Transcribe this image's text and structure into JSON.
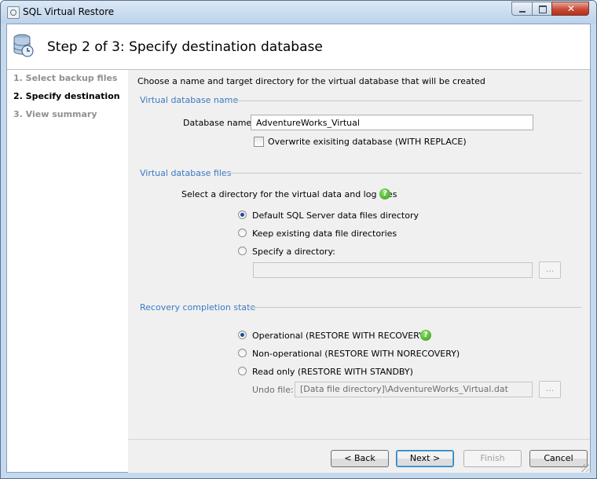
{
  "window": {
    "title": "SQL Virtual Restore",
    "header_title": "Step 2 of 3: Specify destination database",
    "icons": {
      "app": "app-icon",
      "header": "database-clock-icon",
      "close": "close-icon"
    }
  },
  "sidebar": {
    "steps": [
      {
        "label": "1. Select backup files",
        "active": false
      },
      {
        "label": "2. Specify destination",
        "active": true
      },
      {
        "label": "3. View summary",
        "active": false
      }
    ]
  },
  "main": {
    "intro": "Choose a name and target directory for the virtual database that will be created",
    "name_group": {
      "title": "Virtual database name",
      "db_name_label": "Database name:",
      "db_name_value": "AdventureWorks_Virtual",
      "overwrite_label": "Overwrite exisiting database (WITH REPLACE)",
      "overwrite_checked": false
    },
    "files_group": {
      "title": "Virtual database files",
      "prompt": "Select a directory for the virtual data and log files",
      "options": [
        {
          "label": "Default SQL Server data files directory",
          "selected": true
        },
        {
          "label": "Keep existing data file directories",
          "selected": false
        },
        {
          "label": "Specify a directory:",
          "selected": false
        }
      ],
      "directory_value": "",
      "browse_label": "..."
    },
    "recovery_group": {
      "title": "Recovery completion state",
      "options": [
        {
          "label": "Operational (RESTORE WITH RECOVERY)",
          "selected": true
        },
        {
          "label": "Non-operational (RESTORE WITH NORECOVERY)",
          "selected": false
        },
        {
          "label": "Read only (RESTORE WITH STANDBY)",
          "selected": false
        }
      ],
      "undo_label": "Undo file:",
      "undo_value": "[Data file directory]\\AdventureWorks_Virtual.dat",
      "browse_label": "..."
    }
  },
  "footer": {
    "back": "< Back",
    "next": "Next >",
    "finish": "Finish",
    "cancel": "Cancel"
  },
  "colors": {
    "group_title": "#3b79c4",
    "titlebar": "#c5d9ee",
    "help_icon": "#2e9a17"
  }
}
